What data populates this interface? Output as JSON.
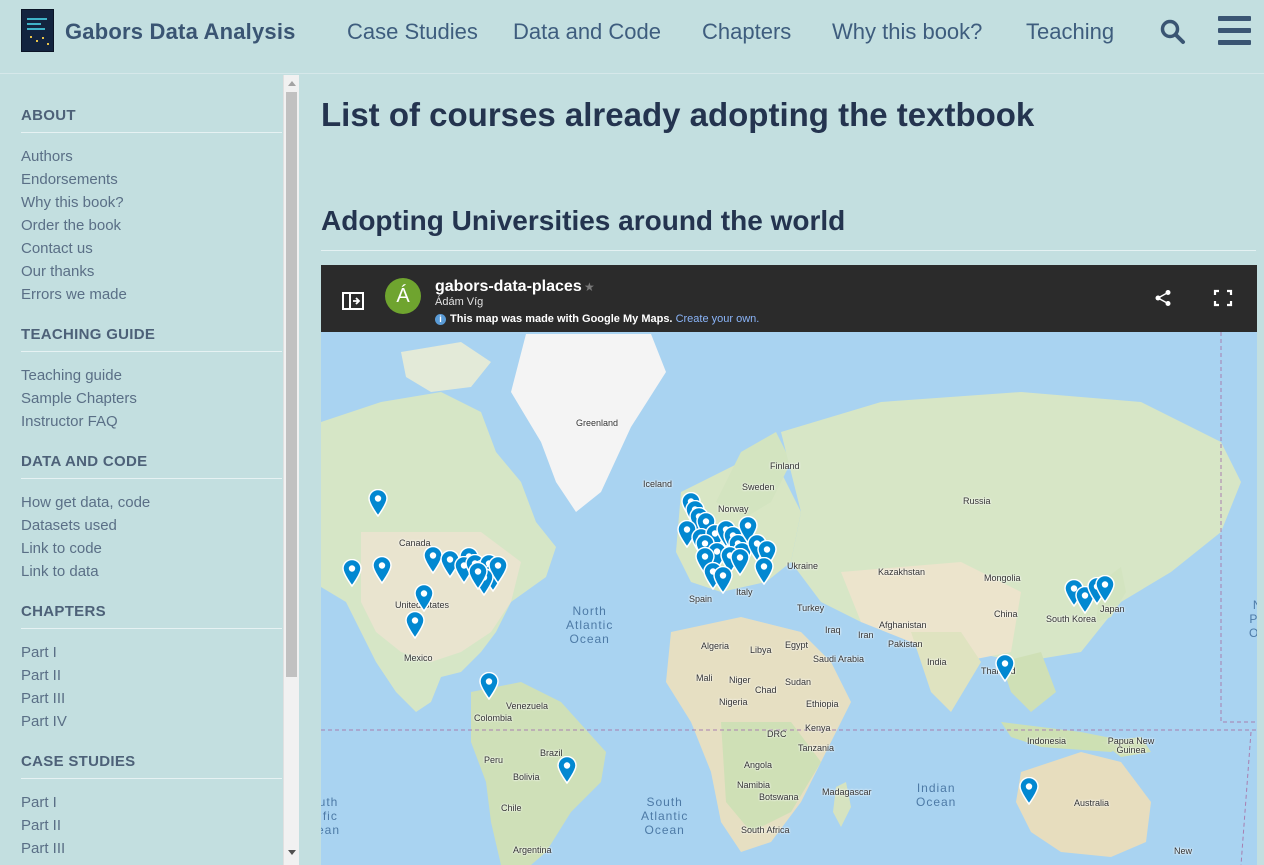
{
  "header": {
    "brand": "Gabors Data Analysis",
    "nav": [
      {
        "label": "Case Studies"
      },
      {
        "label": "Data and Code"
      },
      {
        "label": "Chapters"
      },
      {
        "label": "Why this book?"
      },
      {
        "label": "Teaching"
      }
    ],
    "icons": {
      "search": "search-icon",
      "menu": "hamburger-menu-icon"
    }
  },
  "sidebar": {
    "sections": [
      {
        "title": "ABOUT",
        "items": [
          "Authors",
          "Endorsements",
          "Why this book?",
          "Order the book",
          "Contact us",
          "Our thanks",
          "Errors we made"
        ]
      },
      {
        "title": "TEACHING GUIDE",
        "items": [
          "Teaching guide",
          "Sample Chapters",
          "Instructor FAQ"
        ]
      },
      {
        "title": "DATA AND CODE",
        "items": [
          "How get data, code",
          "Datasets used",
          "Link to code",
          "Link to data"
        ]
      },
      {
        "title": "CHAPTERS",
        "items": [
          "Part I",
          "Part II",
          "Part III",
          "Part IV"
        ]
      },
      {
        "title": "CASE STUDIES",
        "items": [
          "Part I",
          "Part II",
          "Part III"
        ]
      }
    ]
  },
  "main": {
    "page_title": "List of courses already adopting the textbook",
    "section_title": "Adopting Universities around the world"
  },
  "map": {
    "title": "gabors-data-places",
    "avatar_letter": "Á",
    "owner": "Ádám Víg",
    "note": "This map was made with Google My Maps.",
    "note_link": "Create your own.",
    "accent_color": "#6fa42f",
    "pin_color": "#0288d1",
    "labels": [
      "Greenland",
      "Iceland",
      "Finland",
      "Sweden",
      "Norway",
      "Russia",
      "Canada",
      "United States",
      "Mexico",
      "Venezuela",
      "Colombia",
      "Brazil",
      "Peru",
      "Bolivia",
      "Chile",
      "Argentina",
      "Ukraine",
      "Kazakhstan",
      "Mongolia",
      "Spain",
      "Italy",
      "Turkey",
      "Iraq",
      "Iran",
      "Afghanistan",
      "Pakistan",
      "China",
      "South Korea",
      "Japan",
      "India",
      "Thailand",
      "Indonesia",
      "Papua New Guinea",
      "Australia",
      "New",
      "Algeria",
      "Libya",
      "Egypt",
      "Saudi Arabia",
      "Mali",
      "Niger",
      "Chad",
      "Sudan",
      "Nigeria",
      "Ethiopia",
      "DRC",
      "Kenya",
      "Tanzania",
      "Angola",
      "Namibia",
      "Botswana",
      "Madagascar",
      "South Africa"
    ],
    "oceans": [
      "North Atlantic Ocean",
      "South Atlantic Ocean",
      "Indian Ocean",
      "South Pacific Ocean",
      "North Pacific Ocean"
    ]
  }
}
